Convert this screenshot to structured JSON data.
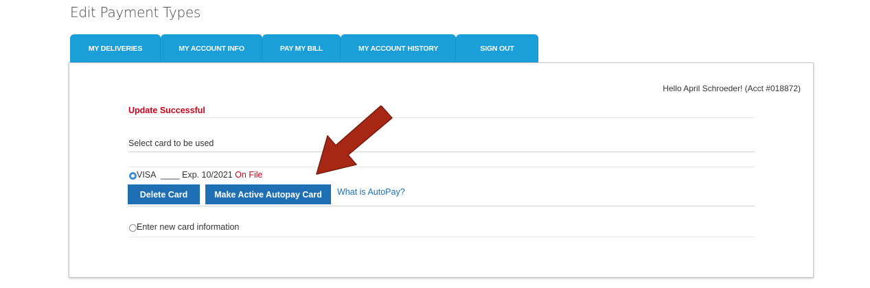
{
  "header": {
    "title": "Edit Payment Types"
  },
  "nav": {
    "tabs": [
      {
        "label": "MY DELIVERIES"
      },
      {
        "label": "MY ACCOUNT INFO"
      },
      {
        "label": "PAY MY BILL"
      },
      {
        "label": "MY ACCOUNT HISTORY"
      },
      {
        "label": "SIGN OUT"
      }
    ]
  },
  "panel": {
    "greeting": "Hello April Schroeder! (Acct #018872)",
    "status_message": "Update Successful",
    "select_label": "Select card to be used",
    "card": {
      "text": "VISA  ____ Exp. 10/2021 ",
      "status": "On File",
      "selected": true
    },
    "buttons": {
      "delete_label": "Delete Card",
      "autopay_label": "Make Active Autopay Card"
    },
    "autopay_link": "What is AutoPay?",
    "new_card_label": "Enter new card information"
  },
  "colors": {
    "tab_blue": "#1a9fd8",
    "button_blue": "#1e6fb3",
    "error_red": "#d0021b",
    "arrow_red": "#a52714"
  }
}
